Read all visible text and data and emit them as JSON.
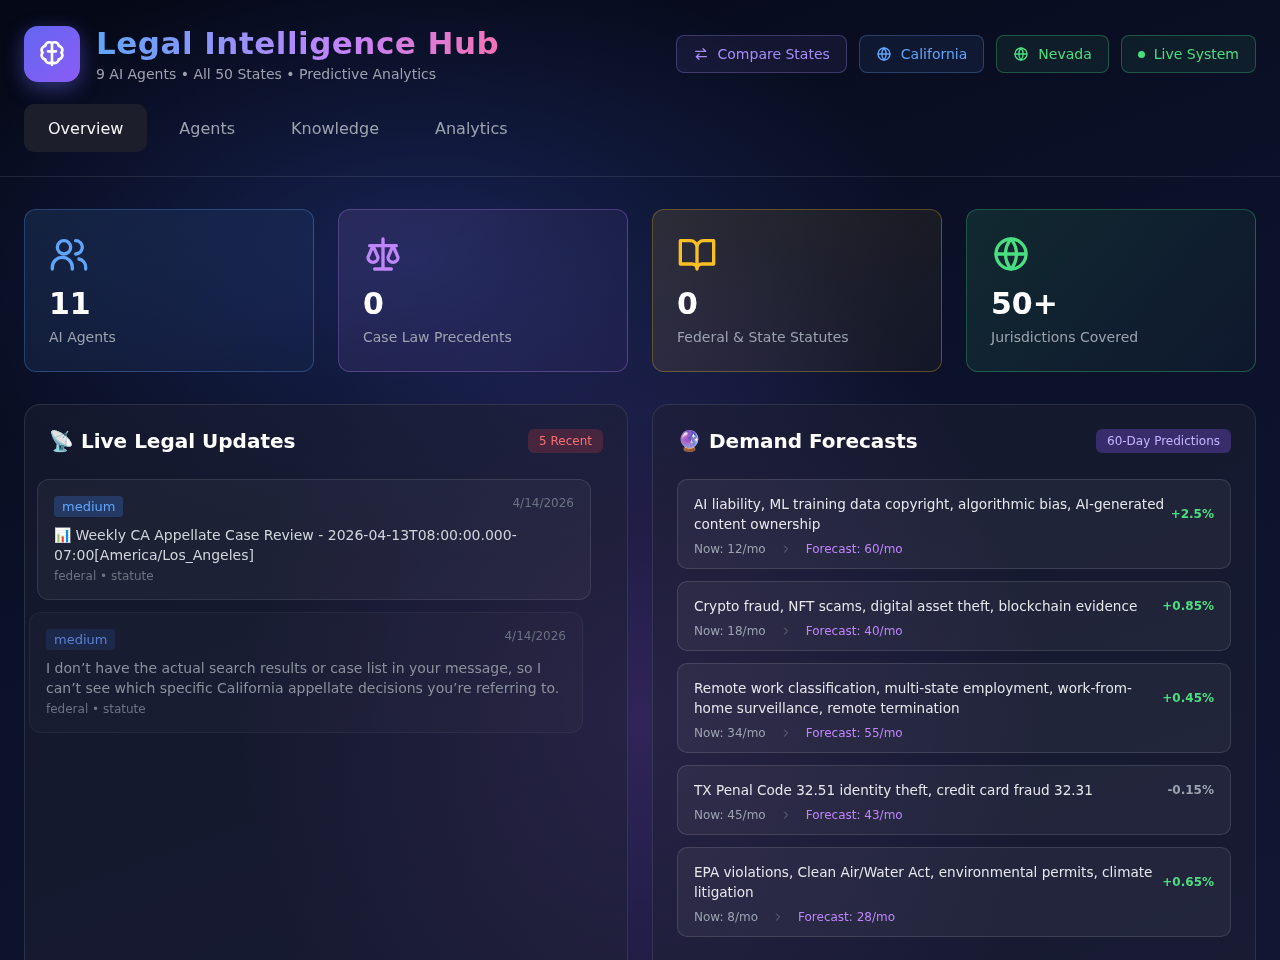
{
  "header": {
    "title": "Legal Intelligence Hub",
    "subtitle": "9 AI Agents • All 50 States • Predictive Analytics",
    "buttons": [
      {
        "kind": "compare",
        "label": "Compare States",
        "color": "#a78bfa"
      },
      {
        "kind": "state",
        "label": "California",
        "color": "#60a5fa"
      },
      {
        "kind": "state",
        "label": "Nevada",
        "color": "#4ade80"
      },
      {
        "kind": "status",
        "label": "Live System",
        "color": "#4ade80"
      }
    ]
  },
  "tabs": [
    {
      "label": "Overview",
      "selected": true
    },
    {
      "label": "Agents",
      "selected": false
    },
    {
      "label": "Knowledge",
      "selected": false
    },
    {
      "label": "Analytics",
      "selected": false
    }
  ],
  "stats": [
    {
      "value": "11",
      "label": "AI Agents",
      "color": "#60a5fa"
    },
    {
      "value": "0",
      "label": "Case Law Precedents",
      "color": "#c084fc"
    },
    {
      "value": "0",
      "label": "Federal & State Statutes",
      "color": "#fbbf24"
    },
    {
      "value": "50+",
      "label": "Jurisdictions Covered",
      "color": "#4ade80"
    }
  ],
  "updates": {
    "title": "📡 Live Legal Updates",
    "badge": "5 Recent",
    "items": [
      {
        "priority": "medium",
        "date": "4/14/2026",
        "text": "📊 Weekly CA Appellate Case Review - 2026-04-13T08:00:00.000-07:00[America/Los_Angeles]",
        "meta": "federal • statute",
        "dimmed": false
      },
      {
        "priority": "medium",
        "date": "4/14/2026",
        "text": "I don’t have the actual search results or case list in your message, so I can’t see which specific California appellate decisions you’re referring to.",
        "meta": "federal • statute",
        "dimmed": true
      }
    ]
  },
  "forecasts": {
    "title": "🔮 Demand Forecasts",
    "badge": "60-Day Predictions",
    "items": [
      {
        "topic": "AI liability, ML training data copyright, algorithmic bias, AI-generated content ownership",
        "change": "+2.5%",
        "color": "#4ade80",
        "now": "Now: 12/mo",
        "forecast": "Forecast: 60/mo"
      },
      {
        "topic": "Crypto fraud, NFT scams, digital asset theft, blockchain evidence",
        "change": "+0.85%",
        "color": "#4ade80",
        "now": "Now: 18/mo",
        "forecast": "Forecast: 40/mo"
      },
      {
        "topic": "Remote work classification, multi-state employment, work-from-home surveillance, remote termination",
        "change": "+0.45%",
        "color": "#4ade80",
        "now": "Now: 34/mo",
        "forecast": "Forecast: 55/mo"
      },
      {
        "topic": "TX Penal Code 32.51 identity theft, credit card fraud 32.31",
        "change": "-0.15%",
        "color": "#9ca3af",
        "now": "Now: 45/mo",
        "forecast": "Forecast: 43/mo"
      },
      {
        "topic": "EPA violations, Clean Air/Water Act, environmental permits, climate litigation",
        "change": "+0.65%",
        "color": "#4ade80",
        "now": "Now: 8/mo",
        "forecast": "Forecast: 28/mo"
      }
    ]
  }
}
